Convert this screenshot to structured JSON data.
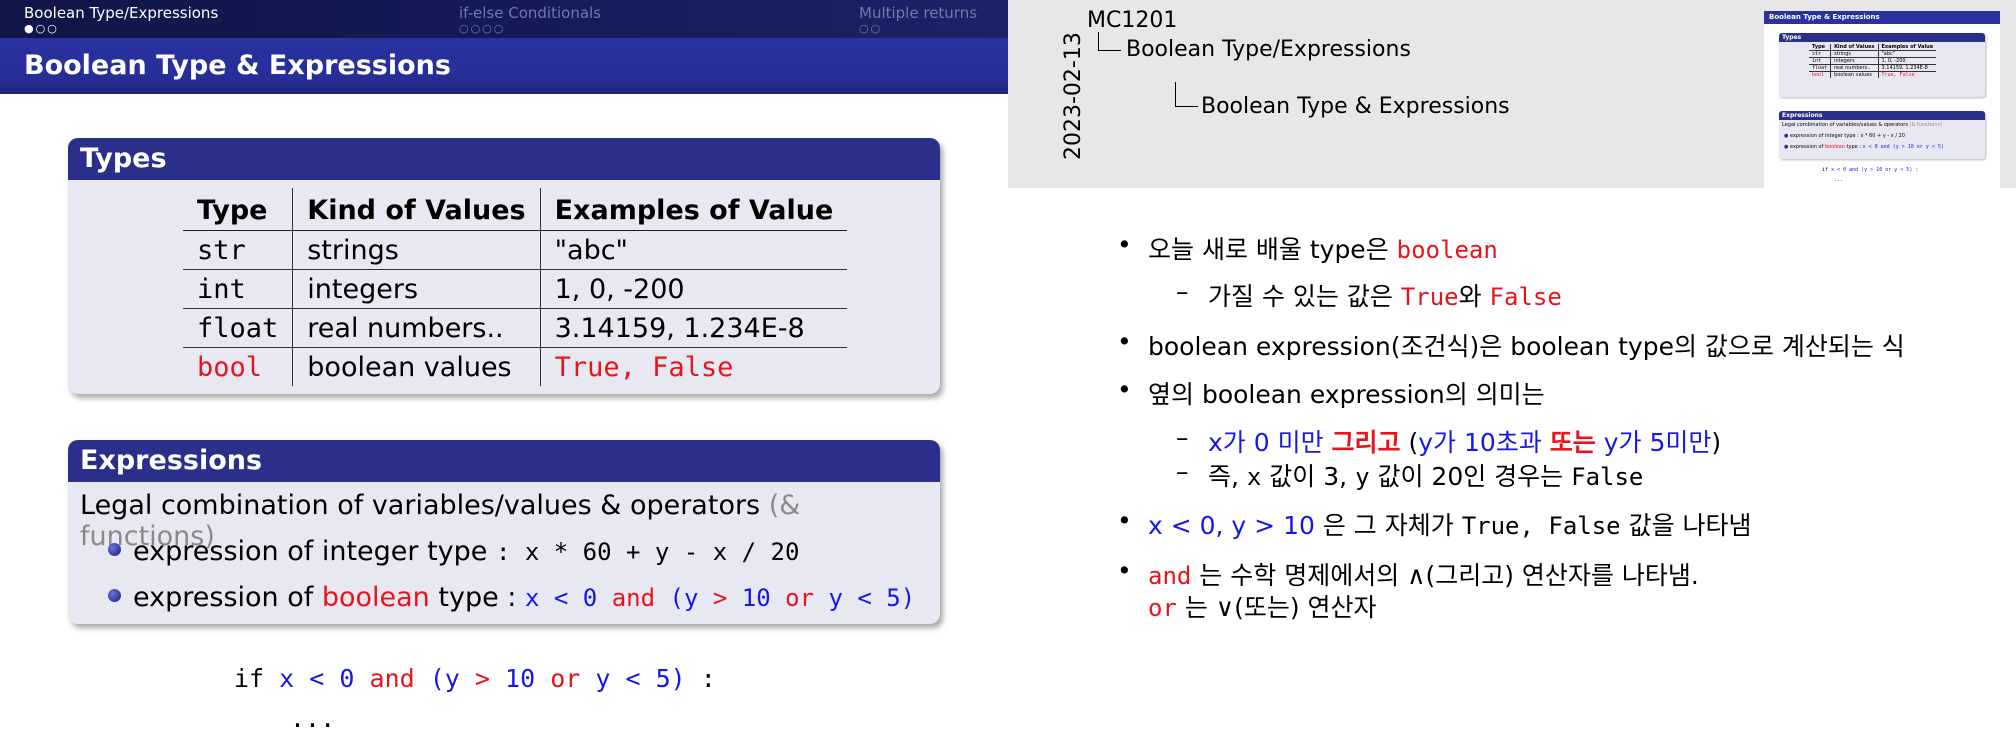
{
  "nav": {
    "sections": [
      {
        "label": "Boolean Type/Expressions",
        "dots": "●○○"
      },
      {
        "label": "if-else Conditionals",
        "dots": "○○○○"
      },
      {
        "label": "Multiple returns",
        "dots": "○○"
      }
    ]
  },
  "slide": {
    "frame_title": "Boolean Type & Expressions",
    "types_block": {
      "title": "Types",
      "headers": [
        "Type",
        "Kind of Values",
        "Examples of Value"
      ],
      "rows": [
        {
          "type": "str",
          "kind": "strings",
          "examples": "\"abc\""
        },
        {
          "type": "int",
          "kind": "integers",
          "examples": "1, 0, -200"
        },
        {
          "type": "float",
          "kind": "real numbers..",
          "examples": "3.14159, 1.234E-8"
        },
        {
          "type": "bool",
          "kind": "boolean values",
          "examples": "True, False"
        }
      ]
    },
    "expr_block": {
      "title": "Expressions",
      "legal": "Legal combination of variables/values & operators",
      "legal_extra": "(& functions)",
      "int_label": "expression of integer type",
      "int_code": ":  x * 60  +  y  -  x / 20",
      "bool_label_1": "expression of",
      "bool_word": "boolean",
      "bool_label_2": "type :",
      "bool_code": {
        "x": "x",
        "lt0": "< 0",
        "and": "and",
        "paren_open": "(y",
        "gt": ">",
        "ten": "10",
        "or": "or",
        "y": "y",
        "lt5": "< 5)"
      }
    },
    "code": {
      "if_kw": "if",
      "cond": {
        "x": "x",
        "lt0": "< 0",
        "and": "and",
        "paren_open": "(y",
        "gt": ">",
        "ten": "10",
        "or": "or",
        "y": "y",
        "lt5": "< 5)"
      },
      "colon": ":",
      "ellipsis": "..."
    }
  },
  "notes_header": {
    "date": "2023-02-13",
    "course": "MC1201",
    "section": "Boolean Type/Expressions",
    "subsection": "Boolean Type & Expressions"
  },
  "thumbnail": {
    "title": "Boolean Type & Expressions",
    "types_title": "Types",
    "expr_title": "Expressions",
    "legal": "Legal combination of variables/values & operators",
    "legal_extra": "(& functions)",
    "int_line": "expression of integer type  :  x * 60 + y - x / 20",
    "bool_line_1": "expression of",
    "bool_word": "boolean",
    "bool_line_2": "type :",
    "bool_code": "x < 0 and (y > 10 or y < 5)",
    "code_if": "if",
    "code_cond": "x < 0 and (y > 10 or y < 5)",
    "code_colon": ":",
    "ellipsis": "..."
  },
  "notes": [
    {
      "bullet": "•",
      "pre": "오늘 새로 배울 type은 ",
      "code": "boolean"
    },
    {
      "dash": "–",
      "pre": "가질 수 있는 값은 ",
      "code1": "True",
      "mid": "와 ",
      "code2": "False"
    },
    {
      "bullet": "•",
      "text": "boolean expression(조건식)은 boolean type의 값으로 계산되는 식"
    },
    {
      "bullet": "•",
      "text": "옆의 boolean expression의 의미는"
    },
    {
      "dash": "–",
      "p1": "x가 0 미만 ",
      "p2": "그리고",
      "p3": " (",
      "p4": "y가 10초과 ",
      "p5": "또는",
      "p6": " y가 5미만",
      "p7": ")"
    },
    {
      "dash": "–",
      "p1": "즉, ",
      "c1": "x",
      "p2": " 값이 3, ",
      "c2": "y",
      "p3": " 값이 20인 경우는 ",
      "c3": "False"
    },
    {
      "bullet": "•",
      "c1": "x < 0, y > 10",
      "p1": " 은 그 자체가 ",
      "c2": "True, False",
      "p2": " 값을 나타냄"
    },
    {
      "bullet": "•",
      "c1": "and",
      "p1": " 는 수학 명제에서의 ∧(그리고) 연산자를 나타냄."
    },
    {
      "c1": "or",
      "p1": " 는 ∨(또는) 연산자"
    }
  ]
}
